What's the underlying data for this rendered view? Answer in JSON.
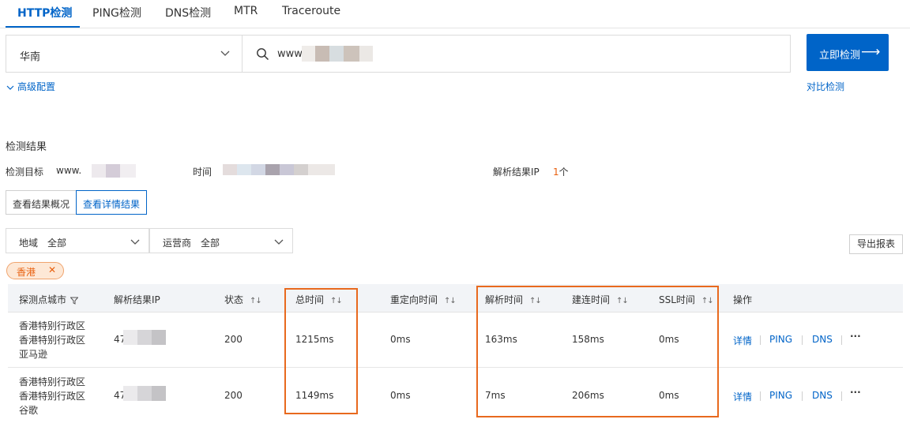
{
  "tabs": [
    {
      "label": "HTTP检测",
      "active": true
    },
    {
      "label": "PING检测",
      "active": false
    },
    {
      "label": "DNS检测",
      "active": false
    },
    {
      "label": "MTR",
      "active": false
    },
    {
      "label": "Traceroute",
      "active": false
    }
  ],
  "search": {
    "region": "华南",
    "url_prefix": "www",
    "submit_label": "立即检测",
    "submit_arrow": "⟶"
  },
  "links": {
    "advanced": "高级配置",
    "compare": "对比检测"
  },
  "results": {
    "title": "检测结果",
    "target_label": "检测目标",
    "target_value": "www.",
    "time_label": "时间",
    "ip_label": "解析结果IP",
    "ip_count": "1",
    "ip_unit": "个"
  },
  "views": {
    "overview": "查看结果概况",
    "detail": "查看详情结果"
  },
  "filters": {
    "region_label": "地域",
    "region_value": "全部",
    "isp_label": "运营商",
    "isp_value": "全部"
  },
  "export_label": "导出报表",
  "chip": {
    "label": "香港",
    "close": "✕"
  },
  "table": {
    "headers": {
      "city": "探测点城市",
      "ip": "解析结果IP",
      "status": "状态",
      "total": "总时间",
      "redirect": "重定向时间",
      "dns": "解析时间",
      "connect": "建连时间",
      "ssl": "SSL时间",
      "ops": "操作"
    },
    "rows": [
      {
        "city1": "香港特别行政区",
        "city2": "香港特别行政区",
        "city3": "亚马逊",
        "ip": "47",
        "status": "200",
        "total": "1215ms",
        "redirect": "0ms",
        "dns": "163ms",
        "connect": "158ms",
        "ssl": "0ms"
      },
      {
        "city1": "香港特别行政区",
        "city2": "香港特别行政区",
        "city3": "谷歌",
        "ip": "47",
        "status": "200",
        "total": "1149ms",
        "redirect": "0ms",
        "dns": "7ms",
        "connect": "206ms",
        "ssl": "0ms"
      }
    ],
    "ops": {
      "detail": "详情",
      "ping": "PING",
      "dns": "DNS",
      "more": "···"
    }
  },
  "colors": {
    "accent": "#0064c8",
    "highlight": "#e8691e"
  }
}
